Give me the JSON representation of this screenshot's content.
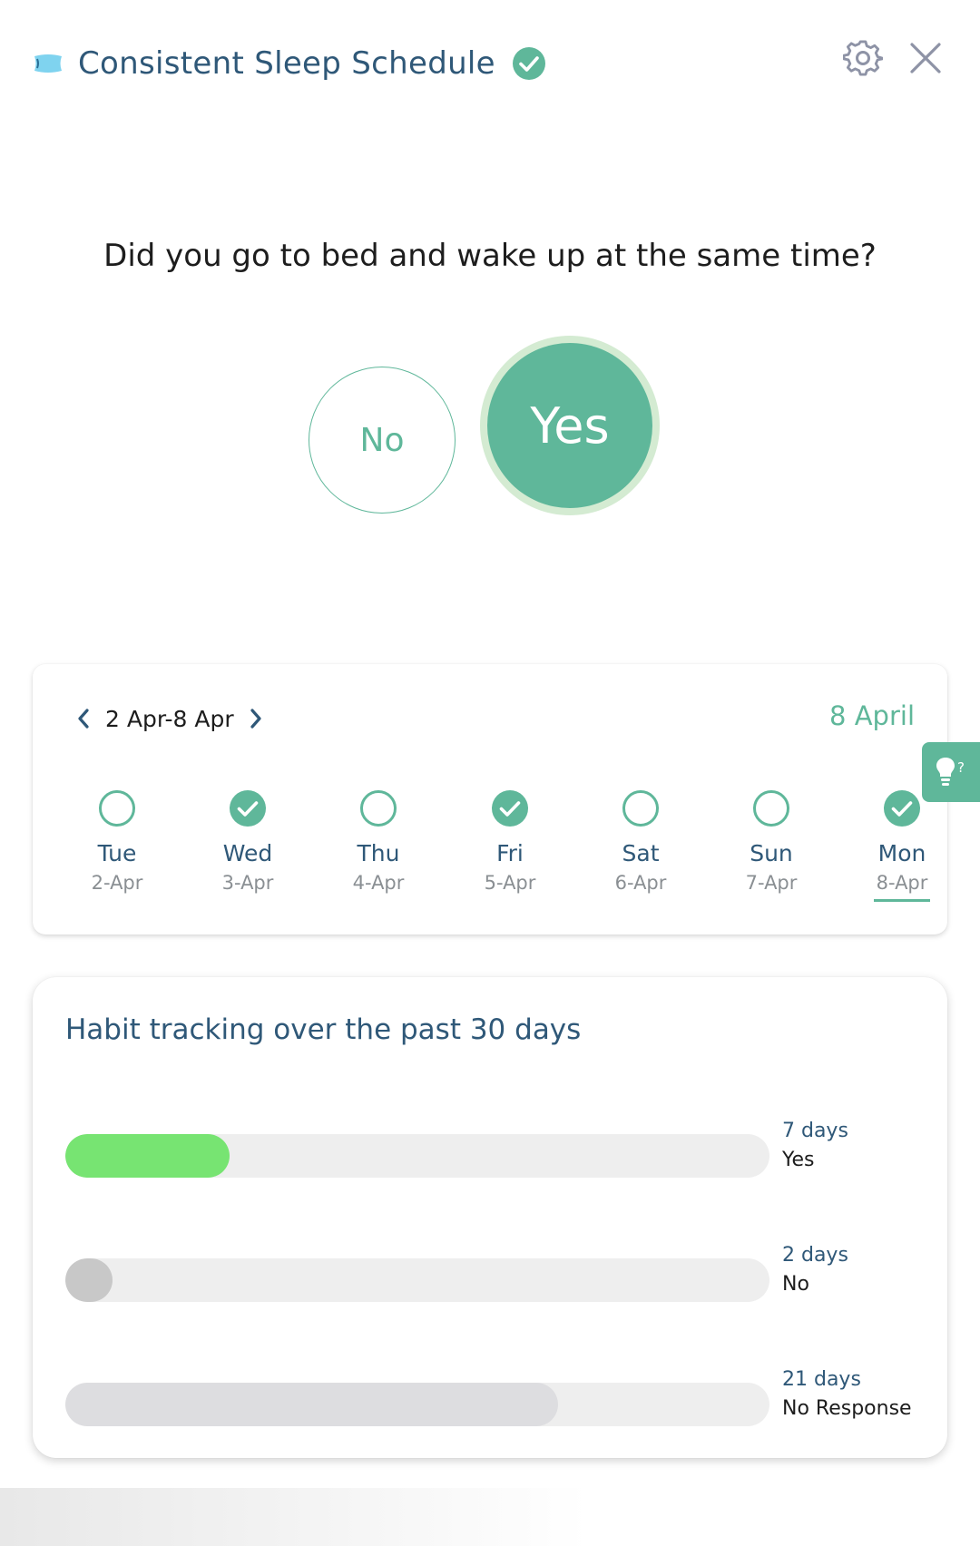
{
  "header": {
    "title": "Consistent Sleep Schedule",
    "icons": [
      "pillow-icon",
      "check-circle-icon",
      "gear-icon",
      "close-icon"
    ]
  },
  "question": "Did you go to bed and wake up at the same time?",
  "answers": {
    "no_label": "No",
    "yes_label": "Yes",
    "selected": "Yes"
  },
  "week": {
    "range": "2 Apr-8 Apr",
    "today": "8 April",
    "days": [
      {
        "name": "Tue",
        "date": "2-Apr",
        "done": false
      },
      {
        "name": "Wed",
        "date": "3-Apr",
        "done": true
      },
      {
        "name": "Thu",
        "date": "4-Apr",
        "done": false
      },
      {
        "name": "Fri",
        "date": "5-Apr",
        "done": true
      },
      {
        "name": "Sat",
        "date": "6-Apr",
        "done": false
      },
      {
        "name": "Sun",
        "date": "7-Apr",
        "done": false
      },
      {
        "name": "Mon",
        "date": "8-Apr",
        "done": true,
        "current": true
      }
    ]
  },
  "help_tab": {
    "icon": "lightbulb-question-icon"
  },
  "habit": {
    "title": "Habit tracking over the past 30 days",
    "rows": [
      {
        "days": "7 days",
        "label": "Yes",
        "fraction": 0.233,
        "color": "#77e472"
      },
      {
        "days": "2 days",
        "label": "No",
        "fraction": 0.067,
        "color": "#c8c8c8"
      },
      {
        "days": "21 days",
        "label": "No Response",
        "fraction": 0.7,
        "color": "#dddde0"
      }
    ]
  },
  "colors": {
    "accent": "#5fb79a",
    "title": "#2f5878",
    "yes_ring": "#d4ebd2"
  }
}
